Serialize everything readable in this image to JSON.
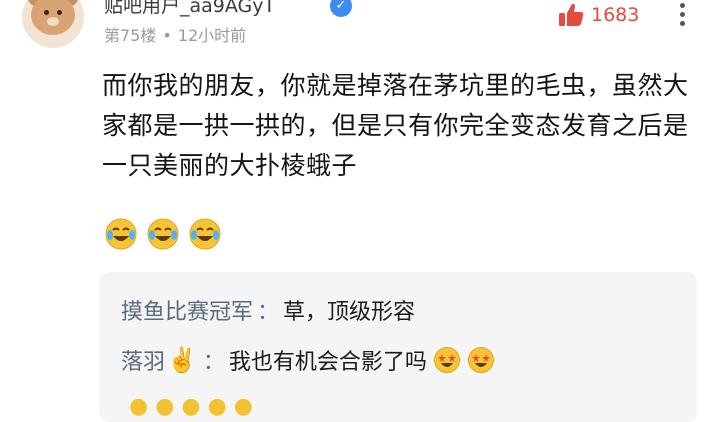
{
  "post": {
    "username": "贴吧用户_aa9AGyT",
    "floor": "第75楼",
    "time": "12小时前",
    "likes": "1683",
    "content": "而你我的朋友，你就是掉落在茅坑里的毛虫，虽然大家都是一拱一拱的，但是只有你完全变态发育之后是一只美丽的大扑棱蛾子",
    "emoji_name": "crying-laughing-emoji",
    "emoji_count": 3
  },
  "replies": [
    {
      "author": "摸鱼比赛冠军",
      "separator": "：",
      "text": "草，顶级形容"
    },
    {
      "author": "落羽",
      "author_emoji": "✌️",
      "separator": "：",
      "text": "我也有机会合影了吗",
      "emoji_name": "starry-eyed-emoji"
    }
  ],
  "colors": {
    "like_red": "#e64a3c",
    "verified_blue": "#3c8cf0",
    "reply_author": "#5a6a7e",
    "reply_bg": "#f5f5f5"
  }
}
